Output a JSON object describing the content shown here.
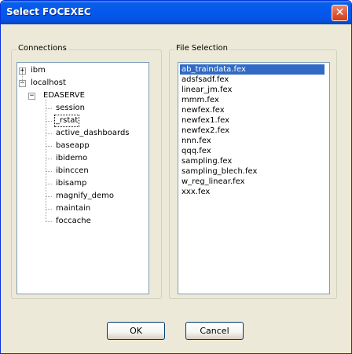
{
  "window": {
    "title": "Select FOCEXEC",
    "close_glyph": "✕"
  },
  "connections": {
    "legend": "Connections",
    "tree": [
      {
        "label": "ibm",
        "level": 0,
        "expander": "+"
      },
      {
        "label": "localhost",
        "level": 0,
        "expander": "−"
      },
      {
        "label": "EDASERVE",
        "level": 1,
        "expander": "−"
      },
      {
        "label": "session",
        "level": 2
      },
      {
        "label": "_rstat",
        "level": 2,
        "selected": true
      },
      {
        "label": "active_dashboards",
        "level": 2
      },
      {
        "label": "baseapp",
        "level": 2
      },
      {
        "label": "ibidemo",
        "level": 2
      },
      {
        "label": "ibinccen",
        "level": 2
      },
      {
        "label": "ibisamp",
        "level": 2
      },
      {
        "label": "magnify_demo",
        "level": 2
      },
      {
        "label": "maintain",
        "level": 2
      },
      {
        "label": "foccache",
        "level": 2
      }
    ]
  },
  "file_selection": {
    "legend": "File Selection",
    "files": [
      {
        "name": "ab_traindata.fex",
        "selected": true
      },
      {
        "name": "adsfsadf.fex"
      },
      {
        "name": "linear_jm.fex"
      },
      {
        "name": "mmm.fex"
      },
      {
        "name": "newfex.fex"
      },
      {
        "name": "newfex1.fex"
      },
      {
        "name": "newfex2.fex"
      },
      {
        "name": "nnn.fex"
      },
      {
        "name": "qqq.fex"
      },
      {
        "name": "sampling.fex"
      },
      {
        "name": "sampling_blech.fex"
      },
      {
        "name": "w_reg_linear.fex"
      },
      {
        "name": "xxx.fex"
      }
    ]
  },
  "buttons": {
    "ok": "OK",
    "cancel": "Cancel"
  },
  "colors": {
    "titlebar": "#0558ee",
    "selection": "#316ac5",
    "dialog_bg": "#ece9d8"
  },
  "icons": {
    "close": "close-icon",
    "expand": "plus-expander-icon",
    "collapse": "minus-expander-icon"
  }
}
